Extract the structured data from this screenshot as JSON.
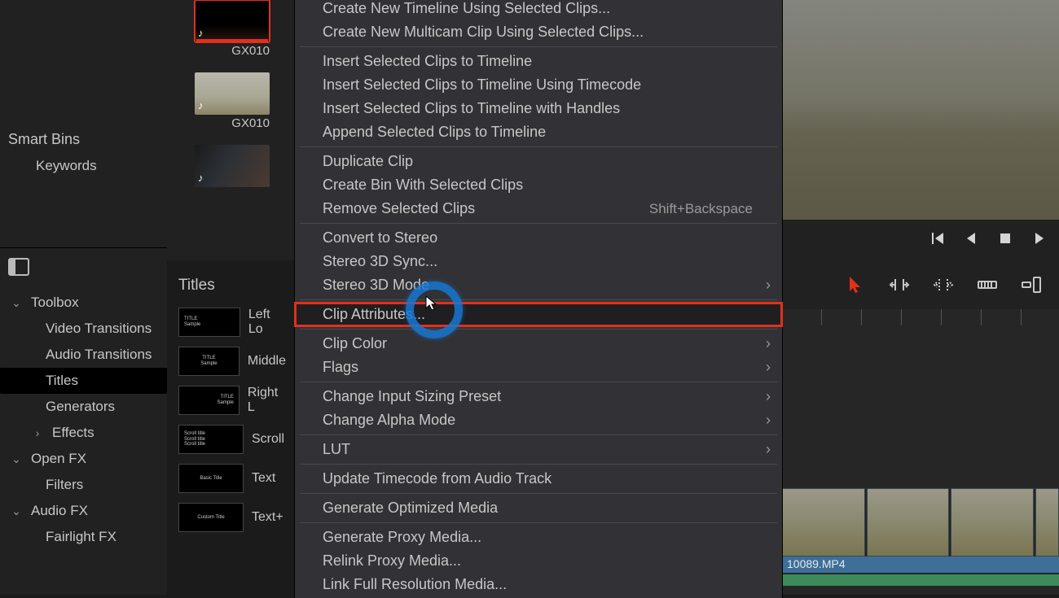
{
  "smartbins": {
    "header": "Smart Bins",
    "keywords": "Keywords"
  },
  "clips": [
    {
      "label": "GX010",
      "selected": true
    },
    {
      "label": "GX010",
      "selected": false
    },
    {
      "label": "",
      "selected": false
    }
  ],
  "tree": {
    "toolbox": "Toolbox",
    "video_transitions": "Video Transitions",
    "audio_transitions": "Audio Transitions",
    "titles": "Titles",
    "generators": "Generators",
    "effects": "Effects",
    "openfx": "Open FX",
    "filters": "Filters",
    "audiofx": "Audio FX",
    "fairlight": "Fairlight FX"
  },
  "titles": {
    "header": "Titles",
    "items": [
      {
        "name": "Left Lo",
        "swatch": [
          "TITLE",
          "Sample"
        ],
        "align": "left"
      },
      {
        "name": "Middle",
        "swatch": [
          "TITLE",
          "Sample"
        ],
        "align": "center"
      },
      {
        "name": "Right L",
        "swatch": [
          "TITLE",
          "Sample"
        ],
        "align": "right"
      },
      {
        "name": "Scroll",
        "swatch": [
          "Scroll title",
          "Scroll title",
          "Scroll title"
        ],
        "align": "left"
      },
      {
        "name": "Text",
        "swatch": [
          "Basic Title"
        ],
        "align": "center"
      },
      {
        "name": "Text+",
        "swatch": [
          "Custom Title"
        ],
        "align": "center"
      }
    ]
  },
  "timeline": {
    "clip_name": "10089.MP4"
  },
  "context_menu": {
    "groups": [
      [
        {
          "label": "Create New Timeline Using Selected Clips..."
        },
        {
          "label": "Create New Multicam Clip Using Selected Clips..."
        }
      ],
      [
        {
          "label": "Insert Selected Clips to Timeline"
        },
        {
          "label": "Insert Selected Clips to Timeline Using Timecode"
        },
        {
          "label": "Insert Selected Clips to Timeline with Handles"
        },
        {
          "label": "Append Selected Clips to Timeline"
        }
      ],
      [
        {
          "label": "Duplicate Clip"
        },
        {
          "label": "Create Bin With Selected Clips"
        },
        {
          "label": "Remove Selected Clips",
          "shortcut": "Shift+Backspace"
        }
      ],
      [
        {
          "label": "Convert to Stereo"
        },
        {
          "label": "Stereo 3D Sync..."
        },
        {
          "label": "Stereo 3D Mode",
          "submenu": true
        }
      ],
      [
        {
          "label": "Clip Attributes...",
          "highlight": true
        }
      ],
      [
        {
          "label": "Clip Color",
          "submenu": true
        },
        {
          "label": "Flags",
          "submenu": true
        }
      ],
      [
        {
          "label": "Change Input Sizing Preset",
          "submenu": true
        },
        {
          "label": "Change Alpha Mode",
          "submenu": true
        }
      ],
      [
        {
          "label": "LUT",
          "submenu": true
        }
      ],
      [
        {
          "label": "Update Timecode from Audio Track"
        }
      ],
      [
        {
          "label": "Generate Optimized Media"
        }
      ],
      [
        {
          "label": "Generate Proxy Media..."
        },
        {
          "label": "Relink Proxy Media..."
        },
        {
          "label": "Link Full Resolution Media..."
        }
      ]
    ]
  }
}
